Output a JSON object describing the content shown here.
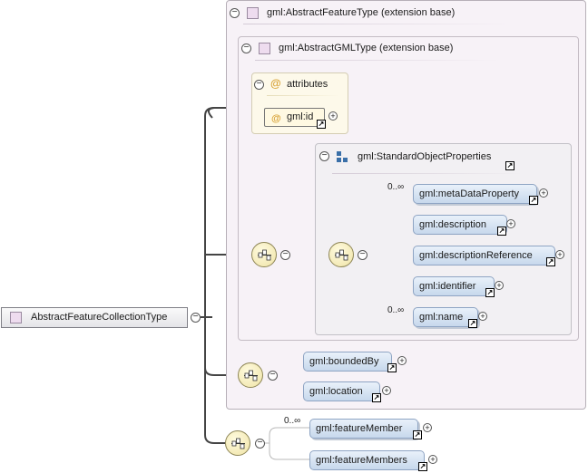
{
  "root": {
    "label": "AbstractFeatureCollectionType"
  },
  "feature_group": {
    "label": "gml:AbstractFeatureType (extension base)"
  },
  "gml_group": {
    "label": "gml:AbstractGMLType (extension base)"
  },
  "attributes": {
    "title": "attributes",
    "id_label": "gml:id"
  },
  "sop_group": {
    "label": "gml:StandardObjectProperties"
  },
  "sop_elements": {
    "metaDataProperty": {
      "label": "gml:metaDataProperty",
      "cardinality": "0..∞"
    },
    "description": {
      "label": "gml:description"
    },
    "descriptionReference": {
      "label": "gml:descriptionReference"
    },
    "identifier": {
      "label": "gml:identifier"
    },
    "name": {
      "label": "gml:name",
      "cardinality": "0..∞"
    }
  },
  "bounding_elements": {
    "boundedBy": {
      "label": "gml:boundedBy"
    },
    "location": {
      "label": "gml:location"
    }
  },
  "member_elements": {
    "featureMember": {
      "label": "gml:featureMember",
      "cardinality": "0..∞"
    },
    "featureMembers": {
      "label": "gml:featureMembers"
    }
  },
  "glyphs": {
    "minus": "−",
    "plus": "+",
    "ref": "↗",
    "at": "@"
  },
  "colors": {
    "element_fill": "#c7d8ec",
    "attribute_fill": "#fdf9ea",
    "group_fill": "#f7f2f7",
    "compositor_fill": "#efe3a5"
  }
}
